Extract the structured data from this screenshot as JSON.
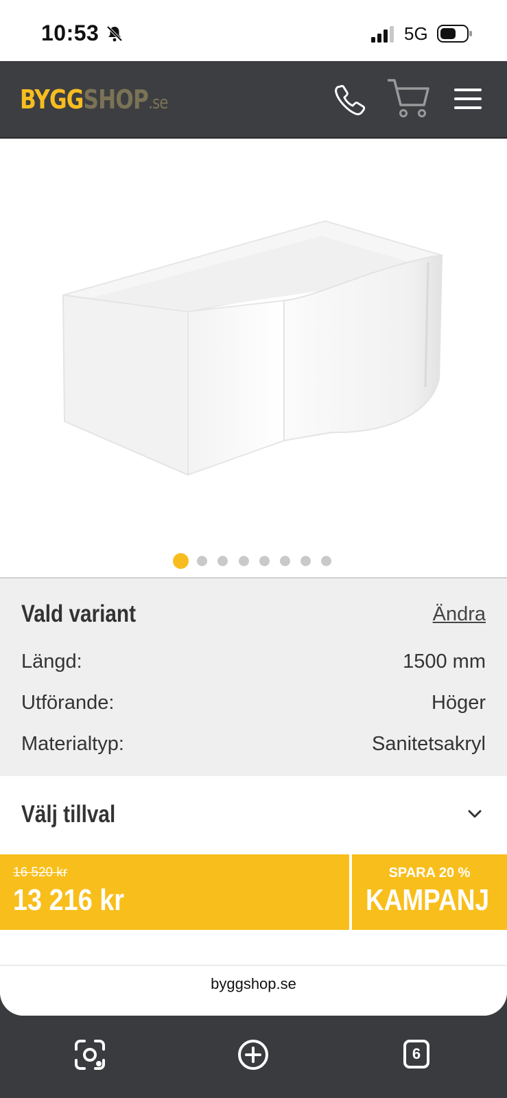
{
  "status_bar": {
    "time": "10:53",
    "network": "5G"
  },
  "header": {
    "logo_part1": "BYGG",
    "logo_part2": "SHOP",
    "logo_part3": ".se",
    "brand_color": "#f7bd1f"
  },
  "gallery": {
    "image_count": 8,
    "active_index": 0
  },
  "variant": {
    "title": "Vald variant",
    "change_label": "Ändra",
    "rows": [
      {
        "key": "Längd:",
        "value": "1500 mm"
      },
      {
        "key": "Utförande:",
        "value": "Höger"
      },
      {
        "key": "Materialtyp:",
        "value": "Sanitetsakryl"
      }
    ]
  },
  "options": {
    "title": "Välj tillval"
  },
  "price": {
    "old": "16 520 kr",
    "current": "13 216 kr",
    "save_label": "SPARA 20 %",
    "campaign_label": "KAMPANJ"
  },
  "browser": {
    "url": "byggshop.se",
    "tab_count": "6"
  }
}
